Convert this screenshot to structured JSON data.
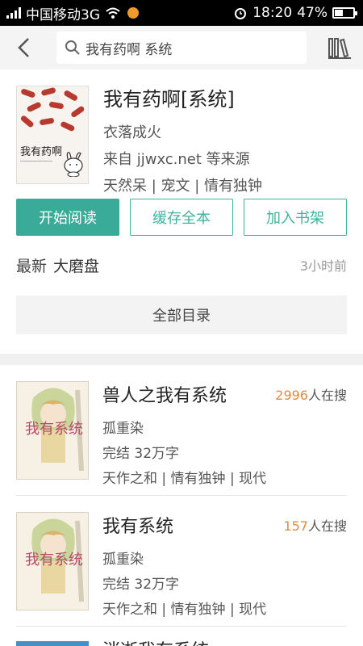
{
  "status": {
    "carrier": "中国移动3G",
    "time": "18:20",
    "battery": "47%",
    "battery_level": 0.47
  },
  "search": {
    "query": "我有药啊 系统"
  },
  "book": {
    "cover_title": "我有药啊",
    "title": "我有药啊[系统]",
    "author": "衣落成火",
    "source": "来自 jjwxc.net 等来源",
    "tags": "天然呆 | 宠文 | 情有独钟"
  },
  "actions": {
    "read": "开始阅读",
    "cache": "缓存全本",
    "shelf": "加入书架"
  },
  "latest": {
    "label": "最新",
    "chapter": "大磨盘",
    "time": "3小时前"
  },
  "catalog": {
    "label": "全部目录"
  },
  "results": [
    {
      "title": "兽人之我有系统",
      "count_num": "2996",
      "count_suffix": "人在搜",
      "author": "孤重染",
      "status": "完结  32万字",
      "tags": "天作之和 | 情有独钟 | 现代",
      "cover_title": "我有系统"
    },
    {
      "title": "我有系统",
      "count_num": "157",
      "count_suffix": "人在搜",
      "author": "孤重染",
      "status": "完结  32万字",
      "tags": "天作之和 | 情有独钟 | 现代",
      "cover_title": "我有系统"
    }
  ],
  "next_peek": {
    "title": "消逝我有系统"
  },
  "colors": {
    "accent": "#3aaa99",
    "count": "#e08a3c",
    "status_bar": "#000000"
  },
  "icons": {
    "back": "chevron-left-icon",
    "search": "search-icon",
    "bookshelf": "bookshelf-icon",
    "wifi": "wifi-icon",
    "alarm": "alarm-icon"
  }
}
